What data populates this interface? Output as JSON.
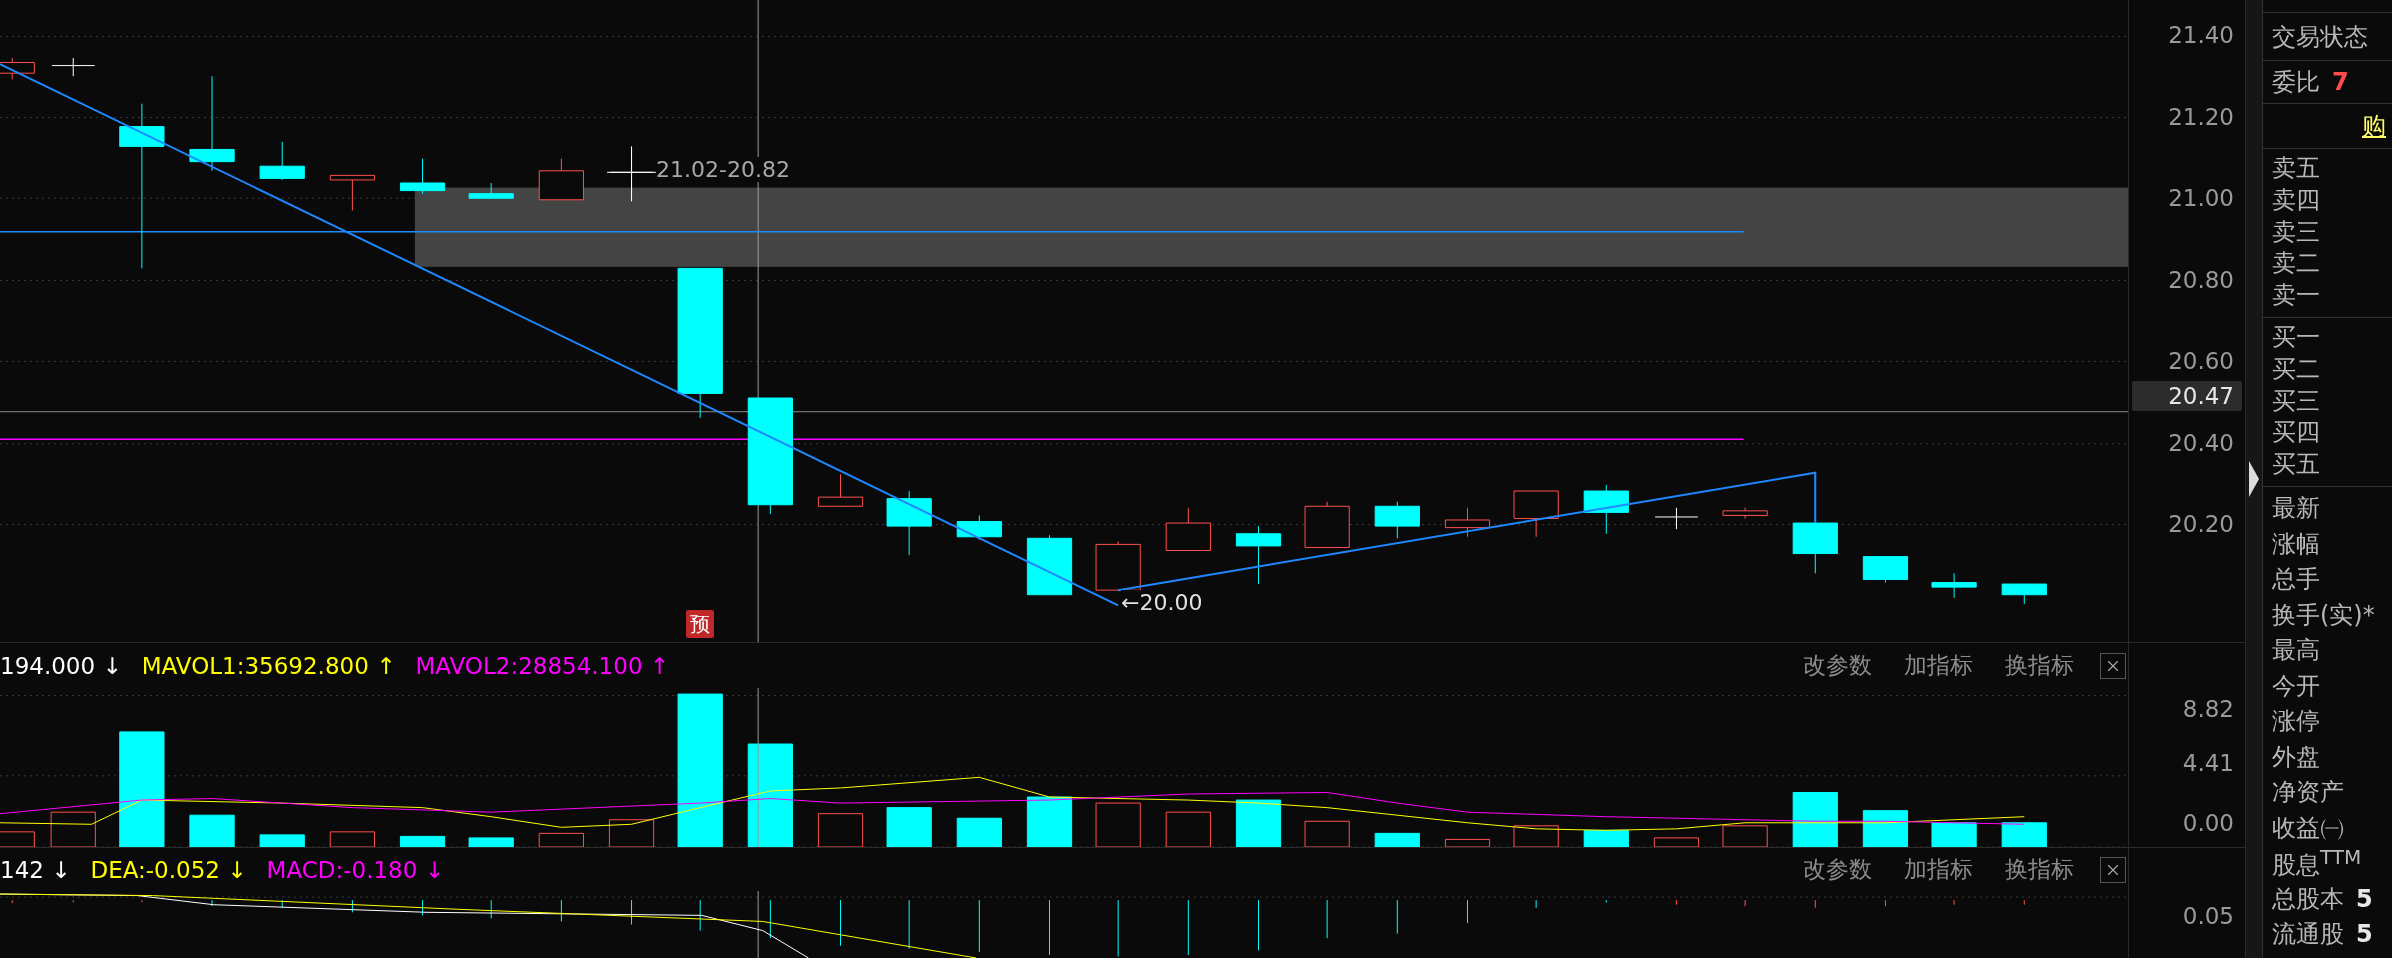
{
  "price_chart": {
    "range_label": "21.02-20.82",
    "low_label": "←20.00",
    "forecast_badge": "预",
    "axis_ticks": [
      "21.40",
      "21.20",
      "21.00",
      "20.80",
      "20.60",
      "20.40",
      "20.20"
    ],
    "current_price": "20.47"
  },
  "volume_panel": {
    "readings": [
      {
        "text": "194.000 ↓",
        "color": "#ffffff"
      },
      {
        "text": "MAVOL1:35692.800 ↑",
        "color": "#ffff00"
      },
      {
        "text": "MAVOL2:28854.100 ↑",
        "color": "#ff00ff"
      }
    ],
    "buttons": [
      "改参数",
      "加指标",
      "换指标"
    ],
    "axis_ticks": [
      "8.82",
      "4.41",
      "0.00"
    ]
  },
  "macd_panel": {
    "readings": [
      {
        "text": "142 ↓",
        "color": "#ffffff"
      },
      {
        "text": "DEA:-0.052 ↓",
        "color": "#ffff00"
      },
      {
        "text": "MACD:-0.180 ↓",
        "color": "#ff00ff"
      }
    ],
    "buttons": [
      "改参数",
      "加指标",
      "换指标"
    ],
    "axis_ticks": [
      "0.05"
    ]
  },
  "quote_panel": {
    "status_label": "交易状态",
    "ratio": {
      "label": "委比",
      "value": "7"
    },
    "buy_button": "购",
    "asks": [
      "卖五",
      "卖四",
      "卖三",
      "卖二",
      "卖一"
    ],
    "bids": [
      "买一",
      "买二",
      "买三",
      "买四",
      "买五"
    ],
    "stats": [
      {
        "label": "最新"
      },
      {
        "label": "涨幅"
      },
      {
        "label": "总手"
      },
      {
        "label": "换手(实)*"
      },
      {
        "label": "最高"
      },
      {
        "label": "今开"
      },
      {
        "label": "涨停"
      },
      {
        "label": "外盘"
      },
      {
        "label": "净资产"
      },
      {
        "label": "收益㈠"
      },
      {
        "label": "股息$^{TTM}$"
      },
      {
        "label": "总股本",
        "value": "5"
      },
      {
        "label": "流通股",
        "value": "5"
      }
    ]
  }
}
